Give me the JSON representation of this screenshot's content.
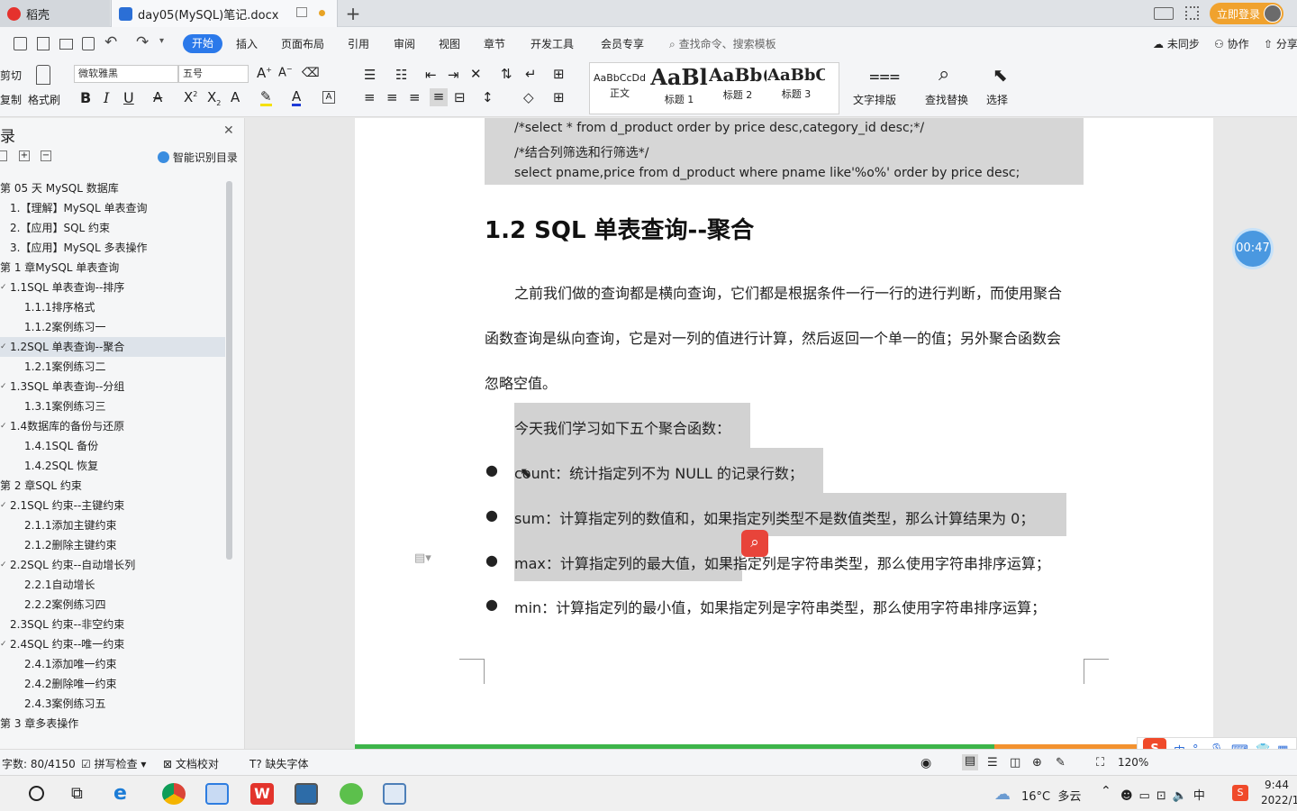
{
  "tabs": {
    "home": "稻壳",
    "doc": "day05(MySQL)笔记.docx"
  },
  "header": {
    "login": "立即登录",
    "unsynced": "未同步",
    "collab": "协作",
    "share": "分享",
    "search_placeholder": "查找命令、搜索模板"
  },
  "menus": [
    "开始",
    "插入",
    "页面布局",
    "引用",
    "审阅",
    "视图",
    "章节",
    "开发工具",
    "会员专享"
  ],
  "ribbon": {
    "cut": "剪切",
    "copy": "复制",
    "format_painter": "格式刷",
    "font": "微软雅黑",
    "size": "五号",
    "style_normal_preview": "AaBbCcDd",
    "style_normal": "正文",
    "style_h1_preview": "AaBl",
    "style_h1": "标题 1",
    "style_h2_preview": "AaBb(",
    "style_h2": "标题 2",
    "style_h3_preview": "AaBbC",
    "style_h3": "标题 3",
    "text_layout": "文字排版",
    "find_replace": "查找替换",
    "select": "选择"
  },
  "sidebar": {
    "title": "录",
    "smart_toc": "智能识别目录",
    "items": [
      {
        "text": "第 05 天  MySQL 数据库",
        "level": 0
      },
      {
        "text": "1.【理解】MySQL 单表查询",
        "level": 1
      },
      {
        "text": "2.【应用】SQL 约束",
        "level": 1
      },
      {
        "text": "3.【应用】MySQL 多表操作",
        "level": 1
      },
      {
        "text": "第 1 章MySQL 单表查询",
        "level": 0
      },
      {
        "text": "1.1SQL 单表查询--排序",
        "level": 1,
        "caret": true
      },
      {
        "text": "1.1.1排序格式",
        "level": 2
      },
      {
        "text": "1.1.2案例练习一",
        "level": 2
      },
      {
        "text": "1.2SQL 单表查询--聚合",
        "level": 1,
        "caret": true,
        "selected": true
      },
      {
        "text": "1.2.1案例练习二",
        "level": 2
      },
      {
        "text": "1.3SQL 单表查询--分组",
        "level": 1,
        "caret": true
      },
      {
        "text": "1.3.1案例练习三",
        "level": 2
      },
      {
        "text": "1.4数据库的备份与还原",
        "level": 1,
        "caret": true
      },
      {
        "text": "1.4.1SQL 备份",
        "level": 2
      },
      {
        "text": "1.4.2SQL 恢复",
        "level": 2
      },
      {
        "text": "第 2 章SQL 约束",
        "level": 0
      },
      {
        "text": "2.1SQL 约束--主键约束",
        "level": 1,
        "caret": true
      },
      {
        "text": "2.1.1添加主键约束",
        "level": 2
      },
      {
        "text": "2.1.2删除主键约束",
        "level": 2
      },
      {
        "text": "2.2SQL 约束--自动增长列",
        "level": 1,
        "caret": true
      },
      {
        "text": "2.2.1自动增长",
        "level": 2
      },
      {
        "text": "2.2.2案例练习四",
        "level": 2
      },
      {
        "text": "2.3SQL 约束--非空约束",
        "level": 1
      },
      {
        "text": "2.4SQL 约束--唯一约束",
        "level": 1,
        "caret": true
      },
      {
        "text": "2.4.1添加唯一约束",
        "level": 2
      },
      {
        "text": "2.4.2删除唯一约束",
        "level": 2
      },
      {
        "text": "2.4.3案例练习五",
        "level": 2
      },
      {
        "text": "第 3 章多表操作",
        "level": 0
      }
    ]
  },
  "doc": {
    "code": [
      "/*select * from d_product order by price desc,category_id desc;*/",
      "/*结合列筛选和行筛选*/",
      "select pname,price from d_product where pname like'%o%' order by price desc;"
    ],
    "heading": "1.2 SQL 单表查询--聚合",
    "para": [
      "之前我们做的查询都是横向查询，它们都是根据条件一行一行的进行判断，而使用聚合",
      "函数查询是纵向查询，它是对一列的值进行计算，然后返回一个单一的值；另外聚合函数会",
      "忽略空值。"
    ],
    "intro": "今天我们学习如下五个聚合函数：",
    "bullets": [
      "count：统计指定列不为 NULL 的记录行数；",
      "sum：计算指定列的数值和，如果指定列类型不是数值类型，那么计算结果为 0；",
      "max：计算指定列的最大值，如果指定列是字符串类型，那么使用字符串排序运算；",
      "min：计算指定列的最小值，如果指定列是字符串类型，那么使用字符串排序运算；"
    ]
  },
  "timer": "00:47",
  "status": {
    "wordcount": "字数: 80/4150",
    "spell": "拼写检查",
    "proof": "文档校对",
    "missing_font": "缺失字体",
    "zoom": "120%"
  },
  "taskbar": {
    "weather": "16°C  多云",
    "ime": "中",
    "time": "9:44",
    "date": "2022/1"
  }
}
